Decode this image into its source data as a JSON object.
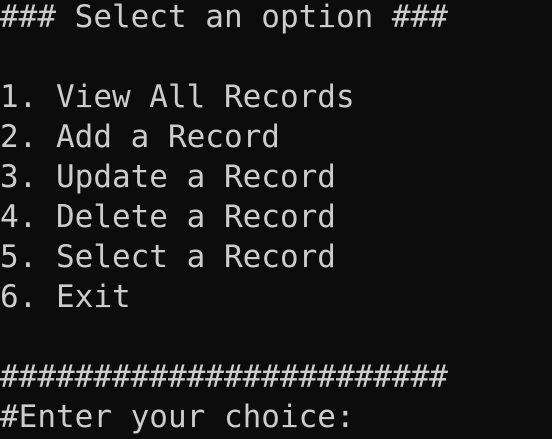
{
  "terminal": {
    "header": "### Select an option ###",
    "menu": [
      "1. View All Records",
      "2. Add a Record",
      "3. Update a Record",
      "4. Delete a Record",
      "5. Select a Record",
      "6. Exit"
    ],
    "separator": "########################",
    "prompt": "#Enter your choice:"
  },
  "colors": {
    "background": "#0c0c0c",
    "text": "#cccccc"
  }
}
